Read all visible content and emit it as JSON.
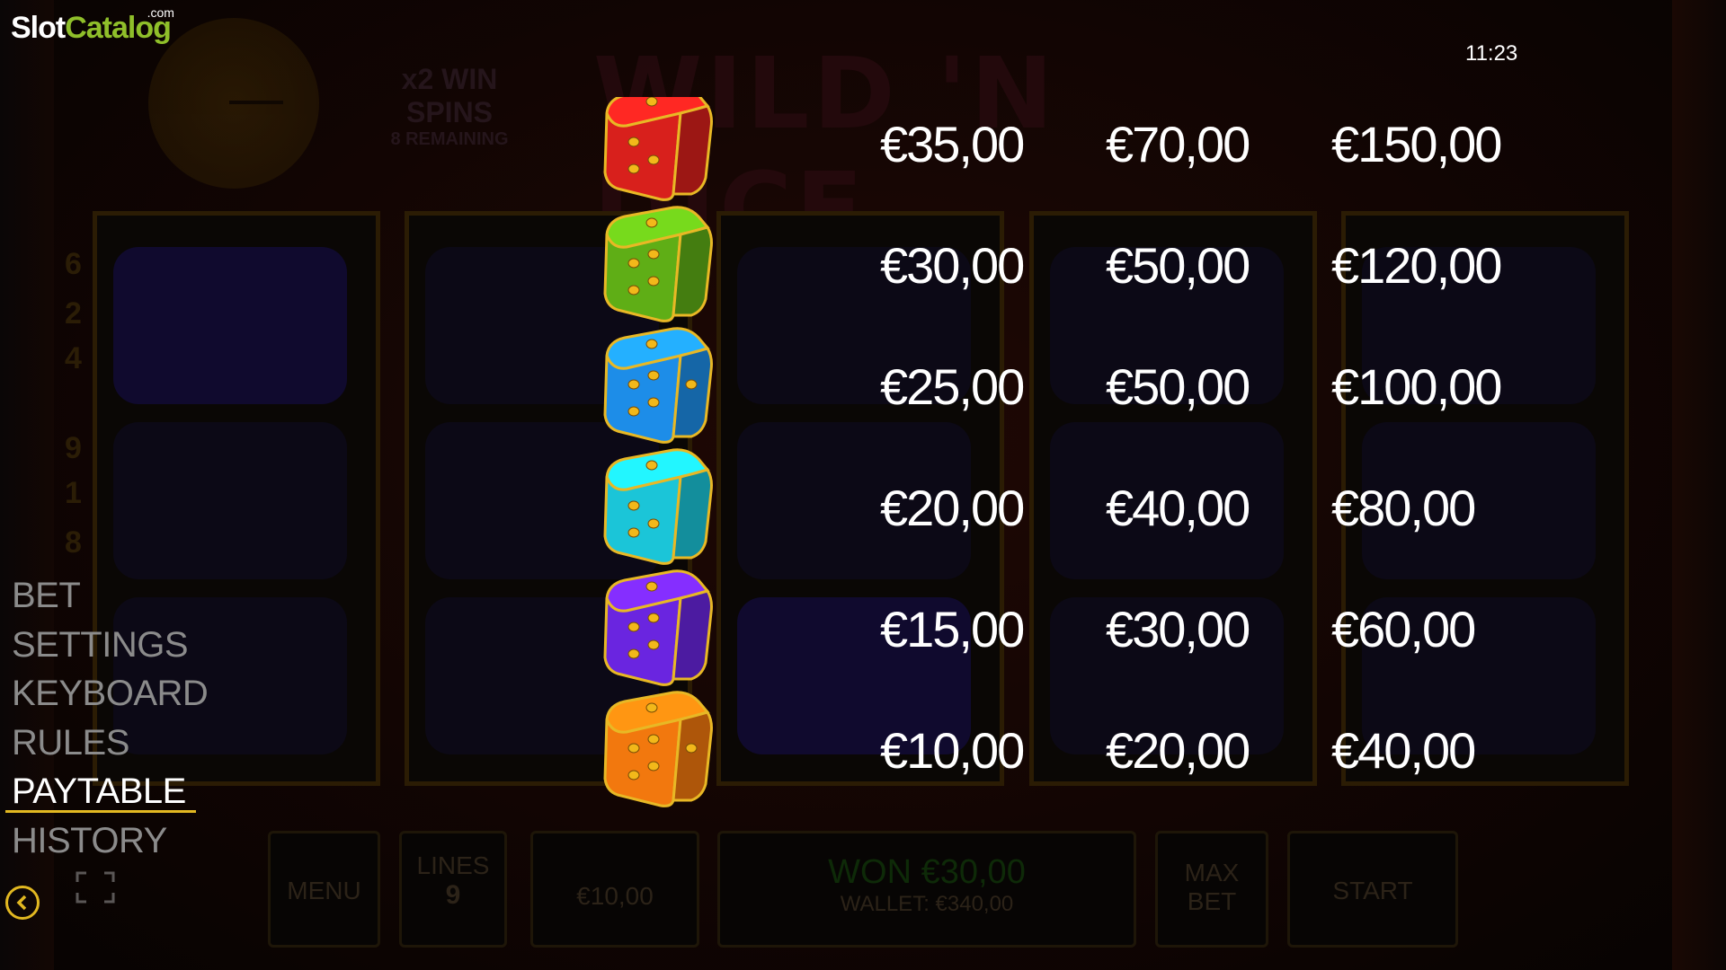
{
  "brand": {
    "slot": "Slot",
    "catalog": "Catalog",
    "com": ".com"
  },
  "clock": "11:23",
  "background": {
    "win_spins": "x2 WIN SPINS",
    "remaining": "8 REMAINING",
    "logo_text": "WILD 'N DICE",
    "line_numbers": [
      "6",
      "2",
      "4",
      "9",
      "1",
      "8"
    ],
    "bottom_bar": {
      "menu": "MENU",
      "lines_label": "LINES",
      "lines_value": "9",
      "bet": "€10,00",
      "won": "WON €30,00",
      "wallet": "WALLET: €340,00",
      "max_bet_1": "MAX",
      "max_bet_2": "BET",
      "start": "START"
    }
  },
  "paytable": {
    "rows": [
      {
        "symbol": "red-die",
        "color": "#d8201c",
        "values": [
          "€35,00",
          "€70,00",
          "€150,00"
        ]
      },
      {
        "symbol": "green-die",
        "color": "#5fae16",
        "values": [
          "€30,00",
          "€50,00",
          "€120,00"
        ]
      },
      {
        "symbol": "blue-die",
        "color": "#1d8de8",
        "values": [
          "€25,00",
          "€50,00",
          "€100,00"
        ]
      },
      {
        "symbol": "cyan-die",
        "color": "#1bc5d8",
        "values": [
          "€20,00",
          "€40,00",
          "€80,00"
        ]
      },
      {
        "symbol": "purple-die",
        "color": "#6a25e0",
        "values": [
          "€15,00",
          "€30,00",
          "€60,00"
        ]
      },
      {
        "symbol": "orange-die",
        "color": "#f2780e",
        "values": [
          "€10,00",
          "€20,00",
          "€40,00"
        ]
      }
    ]
  },
  "menu": {
    "items": [
      "BET",
      "SETTINGS",
      "KEYBOARD",
      "RULES",
      "PAYTABLE",
      "HISTORY"
    ],
    "active": "PAYTABLE",
    "accent": "#e2b821"
  },
  "icons": {
    "back": "chevron-left-icon",
    "fullscreen": "fullscreen-icon"
  }
}
